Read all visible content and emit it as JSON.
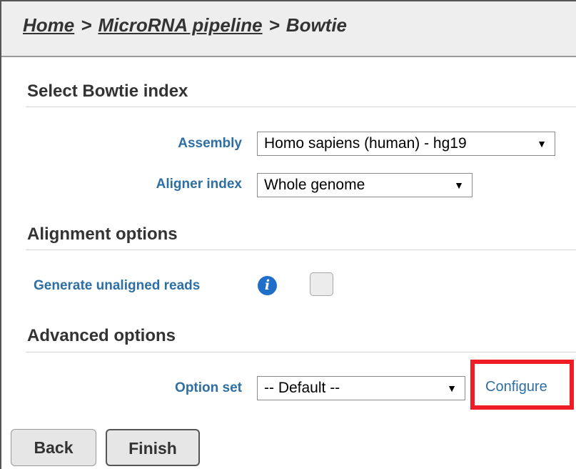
{
  "breadcrumb": {
    "items": [
      "Home",
      "MicroRNA pipeline",
      "Bowtie"
    ],
    "separator": ">"
  },
  "sections": {
    "index": {
      "title": "Select Bowtie index",
      "assembly_label": "Assembly",
      "assembly_value": "Homo sapiens (human) - hg19",
      "aligner_label": "Aligner index",
      "aligner_value": "Whole genome"
    },
    "alignment": {
      "title": "Alignment options",
      "unaligned_label": "Generate unaligned reads",
      "unaligned_checked": false,
      "info_icon": "info-icon"
    },
    "advanced": {
      "title": "Advanced options",
      "option_set_label": "Option set",
      "option_set_value": "-- Default --",
      "configure_label": "Configure"
    }
  },
  "buttons": {
    "back": "Back",
    "finish": "Finish"
  },
  "icons": {
    "info": "i",
    "dropdown": "▼"
  },
  "colors": {
    "label_blue": "#2e6fa3",
    "highlight_red": "#ee1c25",
    "info_blue": "#1f6fc9"
  }
}
